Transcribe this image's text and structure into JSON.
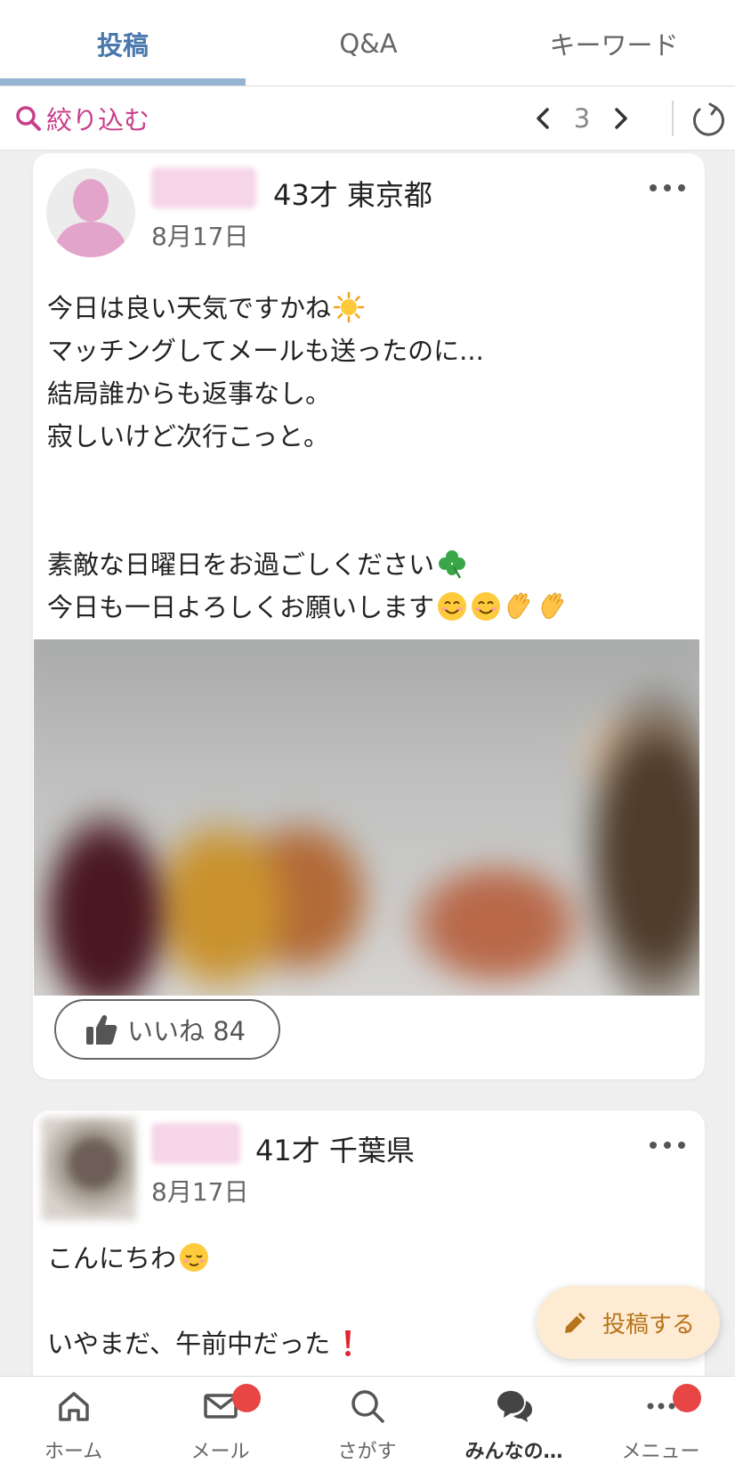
{
  "tabs": [
    {
      "label": "投稿",
      "active": true
    },
    {
      "label": "Q&A",
      "active": false
    },
    {
      "label": "キーワード",
      "active": false
    }
  ],
  "toolbar": {
    "filter_label": "絞り込む",
    "page": "3"
  },
  "posts": [
    {
      "age_pref": "43才 東京都",
      "date": "8月17日",
      "lines": [
        "今日は良い天気ですかね",
        "マッチングしてメールも送ったのに...",
        "結局誰からも返事なし。",
        "寂しいけど次行こっと。",
        "",
        "",
        "素敵な日曜日をお過ごしください",
        "今日も一日よろしくお願いします"
      ],
      "like_label": "いいね 84"
    },
    {
      "age_pref": "41才 千葉県",
      "date": "8月17日",
      "lines": [
        "こんにちわ",
        "",
        "いやまだ、午前中だった"
      ]
    }
  ],
  "fab": {
    "label": "投稿する"
  },
  "nav": [
    {
      "label": "ホーム",
      "icon": "home-icon",
      "badge": false
    },
    {
      "label": "メール",
      "icon": "mail-icon",
      "badge": true
    },
    {
      "label": "さがす",
      "icon": "search-icon",
      "badge": false
    },
    {
      "label": "みんなの…",
      "icon": "chat-bubbles-icon",
      "badge": false,
      "active": true
    },
    {
      "label": "メニュー",
      "icon": "more-icon",
      "badge": true
    }
  ],
  "colors": {
    "accent_blue": "#4a78ad",
    "filter_pink": "#c83e8a",
    "badge_red": "#e84545",
    "fab_bg": "#fdebd4"
  }
}
